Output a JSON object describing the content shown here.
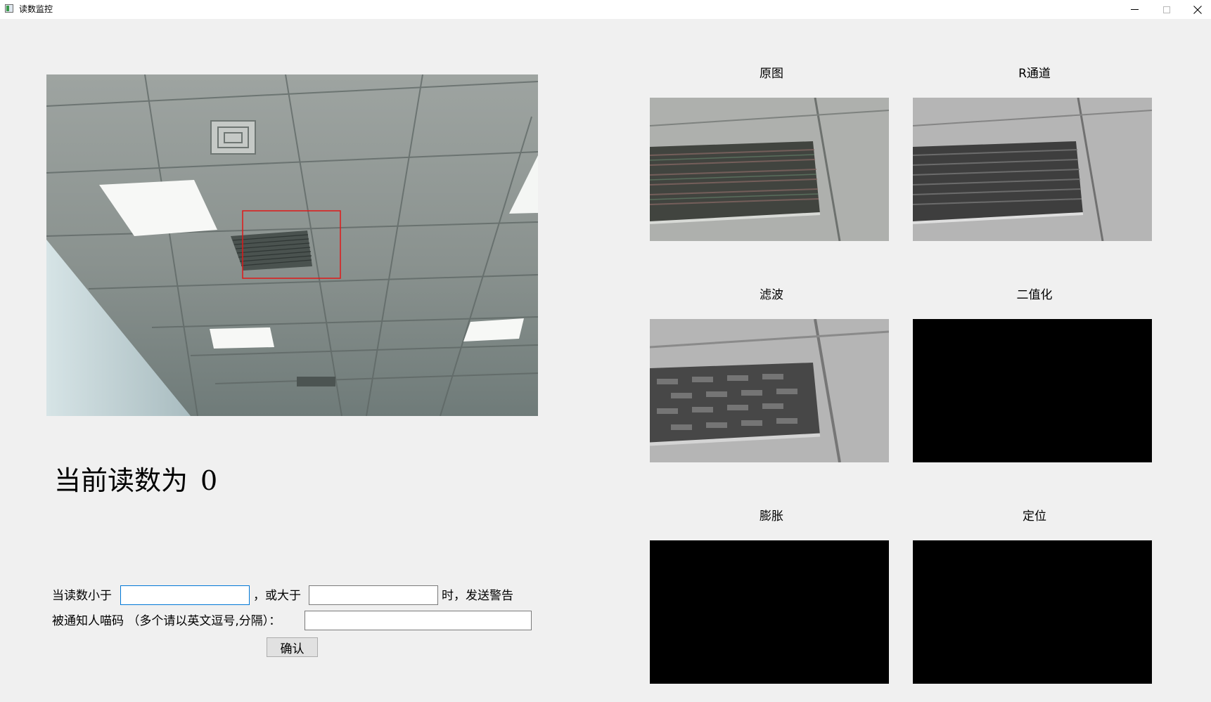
{
  "window": {
    "title": "读数监控",
    "controls": {
      "minimize": "minimize-icon",
      "maximize": "maximize-icon",
      "close": "close-icon"
    }
  },
  "camera": {
    "detection_box_color": "#e01818"
  },
  "reading": {
    "label": "当前读数为",
    "value": "0"
  },
  "alert_form": {
    "below_label": "当读数小于",
    "below_value": "",
    "above_label": "，或大于",
    "above_value": "",
    "suffix_label": "时，发送警告",
    "notify_label": "被通知人喵码 （多个请以英文逗号,分隔）：",
    "notify_value": "",
    "confirm_label": "确认"
  },
  "panels": [
    {
      "label": "原图"
    },
    {
      "label": "R通道"
    },
    {
      "label": "滤波"
    },
    {
      "label": "二值化"
    },
    {
      "label": "膨胀"
    },
    {
      "label": "定位"
    }
  ]
}
